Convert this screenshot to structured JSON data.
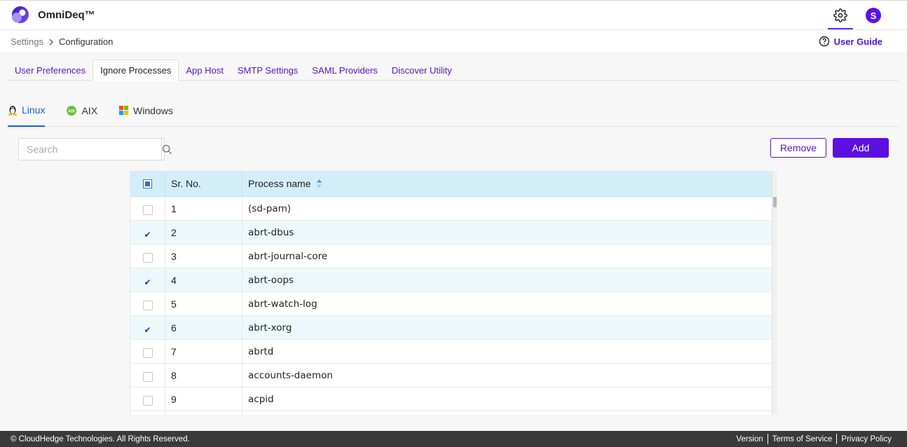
{
  "app": {
    "name": "OmniDeq™",
    "avatar_initial": "S"
  },
  "breadcrumb": {
    "parent": "Settings",
    "current": "Configuration"
  },
  "user_guide": "User Guide",
  "main_tabs": [
    "User Preferences",
    "Ignore Processes",
    "App Host",
    "SMTP Settings",
    "SAML Providers",
    "Discover Utility"
  ],
  "active_main_tab": "Ignore Processes",
  "os_tabs": [
    "Linux",
    "AIX",
    "Windows"
  ],
  "active_os_tab": "Linux",
  "search": {
    "placeholder": "Search",
    "value": ""
  },
  "buttons": {
    "remove": "Remove",
    "add": "Add"
  },
  "table": {
    "columns": [
      "Sr. No.",
      "Process name"
    ],
    "sort_column": "Process name",
    "rows": [
      {
        "sr": "1",
        "name": "(sd-pam)",
        "checked": false
      },
      {
        "sr": "2",
        "name": "abrt-dbus",
        "checked": true
      },
      {
        "sr": "3",
        "name": "abrt-journal-core",
        "checked": false
      },
      {
        "sr": "4",
        "name": "abrt-oops",
        "checked": true
      },
      {
        "sr": "5",
        "name": "abrt-watch-log",
        "checked": false
      },
      {
        "sr": "6",
        "name": "abrt-xorg",
        "checked": true
      },
      {
        "sr": "7",
        "name": "abrtd",
        "checked": false
      },
      {
        "sr": "8",
        "name": "accounts-daemon",
        "checked": false
      },
      {
        "sr": "9",
        "name": "acpid",
        "checked": false
      },
      {
        "sr": "",
        "name": "",
        "checked": false
      }
    ]
  },
  "footer": {
    "copyright": "© CloudHedge Technologies. All Rights Reserved.",
    "links": [
      "Version",
      "Terms of Service",
      "Privacy Policy"
    ]
  },
  "colors": {
    "accent": "#5b12c6",
    "active_tab_blue": "#1a5fd6",
    "header_row": "#d3eef9",
    "alt_row": "#ecf8fc",
    "footer_bg": "#3a3a3a"
  }
}
